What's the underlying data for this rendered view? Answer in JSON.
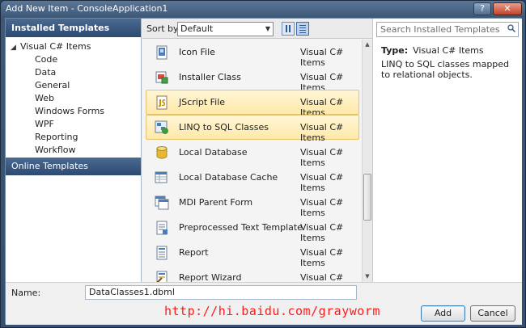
{
  "window": {
    "title": "Add New Item - ConsoleApplication1",
    "close_glyph": "✕",
    "minimize_glyph": "?"
  },
  "left": {
    "header": "Installed Templates",
    "root": "Visual C# Items",
    "items": [
      "Code",
      "Data",
      "General",
      "Web",
      "Windows Forms",
      "WPF",
      "Reporting",
      "Workflow"
    ],
    "online": "Online Templates"
  },
  "sortbar": {
    "label": "Sort by:",
    "selected": "Default"
  },
  "templates": [
    {
      "name": "Icon File",
      "category": "Visual C# Items",
      "icon": "icon-file-icon",
      "highlight": false
    },
    {
      "name": "Installer Class",
      "category": "Visual C# Items",
      "icon": "installer-class-icon",
      "highlight": false
    },
    {
      "name": "JScript File",
      "category": "Visual C# Items",
      "icon": "jscript-file-icon",
      "highlight": true
    },
    {
      "name": "LINQ to SQL Classes",
      "category": "Visual C# Items",
      "icon": "linq-to-sql-icon",
      "highlight": true
    },
    {
      "name": "Local Database",
      "category": "Visual C# Items",
      "icon": "local-database-icon",
      "highlight": false
    },
    {
      "name": "Local Database Cache",
      "category": "Visual C# Items",
      "icon": "local-database-cache-icon",
      "highlight": false
    },
    {
      "name": "MDI Parent Form",
      "category": "Visual C# Items",
      "icon": "mdi-parent-form-icon",
      "highlight": false
    },
    {
      "name": "Preprocessed Text Template",
      "category": "Visual C# Items",
      "icon": "text-template-icon",
      "highlight": false
    },
    {
      "name": "Report",
      "category": "Visual C# Items",
      "icon": "report-icon",
      "highlight": false
    },
    {
      "name": "Report Wizard",
      "category": "Visual C# Items",
      "icon": "report-wizard-icon",
      "highlight": false
    }
  ],
  "right": {
    "search_placeholder": "Search Installed Templates",
    "type_label": "Type:",
    "type_value": "Visual C# Items",
    "description": "LINQ to SQL classes mapped to relational objects."
  },
  "bottom": {
    "name_label": "Name:",
    "name_value": "DataClasses1.dbml",
    "watermark": "http://hi.baidu.com/grayworm",
    "add_label": "Add",
    "cancel_label": "Cancel"
  },
  "colors": {
    "accent": "#2c4a72",
    "highlight": "#ffe9a8",
    "watermark": "#ff1a1a"
  }
}
